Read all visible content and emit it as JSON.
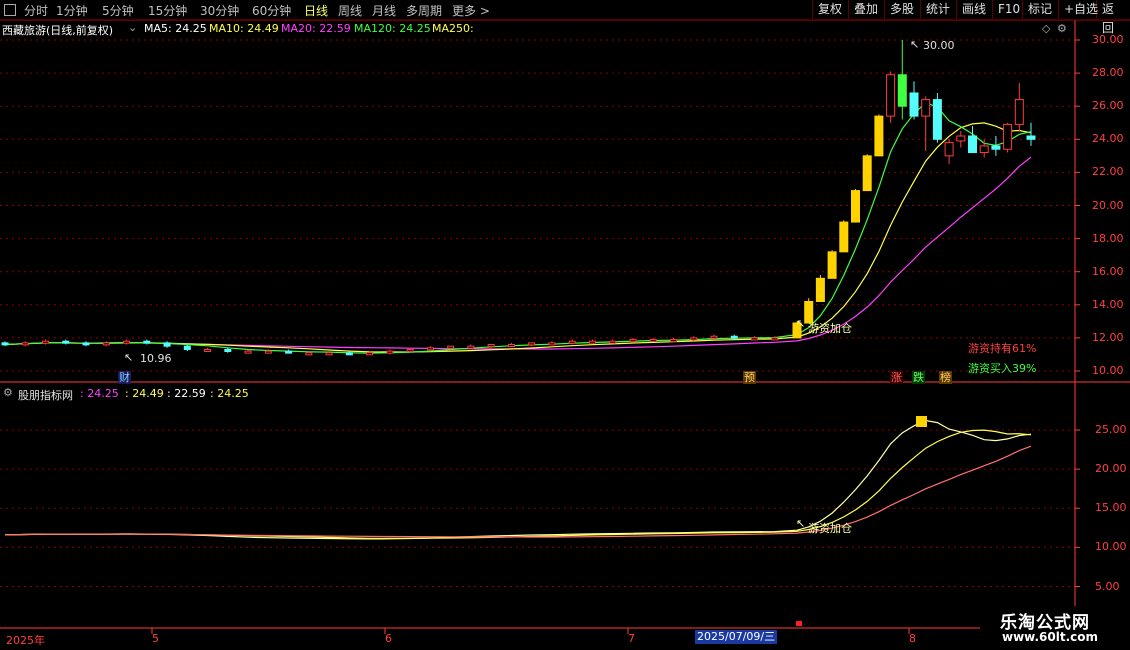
{
  "toolbar": {
    "periods": [
      "分时",
      "1分钟",
      "5分钟",
      "15分钟",
      "30分钟",
      "60分钟",
      "日线",
      "周线",
      "月线",
      "多周期",
      "更多"
    ],
    "active_period": "日线",
    "right_buttons": [
      "复权",
      "叠加",
      "多股",
      "统计",
      "画线",
      "F10",
      "标记",
      "+自选",
      "返回"
    ]
  },
  "header": {
    "stock_title": "西藏旅游(日线,前复权)",
    "ma5": "MA5: 24.25",
    "ma10": "MA10: 24.49",
    "ma20": "MA20: 22.59",
    "ma120": "MA120: 24.25",
    "ma250": "MA250:"
  },
  "main_chart": {
    "y_ticks": [
      "30.00",
      "28.00",
      "26.00",
      "24.00",
      "22.00",
      "20.00",
      "18.00",
      "16.00",
      "14.00",
      "12.00",
      "10.00"
    ],
    "high_label": "30.00",
    "low_label": "10.96",
    "annotation": "游资加仓",
    "hold_text": "游资持有61%",
    "buy_text": "游资买入39%",
    "markers": {
      "cai": "财",
      "yu": "预",
      "zhang": "涨",
      "die": "跌",
      "bang": "榜"
    }
  },
  "indicator": {
    "title": "股朋指标网",
    "values": [
      ": 24.25",
      ": 24.49",
      ": 22.59",
      ": 24.25"
    ],
    "y_ticks": [
      "25.00",
      "20.00",
      "15.00",
      "10.00",
      "5.00"
    ],
    "annotation": "游资加仓"
  },
  "x_axis": {
    "labels": [
      "2025年",
      "5",
      "6",
      "7",
      "8"
    ],
    "cursor_date": "2025/07/09/三"
  },
  "brand": {
    "title": "乐淘公式网",
    "url": "www.60lt.com"
  },
  "colors": {
    "up": "#ff3c3c",
    "down_cyan": "#54fcfc",
    "limit_up": "#ffd200",
    "ma5": "#ffffff",
    "ma10": "#ffff4d",
    "ma20": "#ff40ff",
    "ma120": "#40ff40",
    "grid": "#8b0000",
    "axis": "#ff3c3c"
  },
  "chart_data": {
    "type": "candlestick",
    "series": [
      {
        "name": "MA5",
        "values": [
          24.25
        ]
      },
      {
        "name": "MA10",
        "values": [
          24.49
        ]
      },
      {
        "name": "MA20",
        "values": [
          22.59
        ]
      },
      {
        "name": "MA120",
        "values": [
          24.25
        ]
      }
    ],
    "candles": [
      [
        11.7,
        11.8,
        11.5,
        11.6
      ],
      [
        11.6,
        11.8,
        11.5,
        11.7
      ],
      [
        11.7,
        11.9,
        11.6,
        11.8
      ],
      [
        11.8,
        11.9,
        11.6,
        11.7
      ],
      [
        11.7,
        11.8,
        11.5,
        11.6
      ],
      [
        11.6,
        11.8,
        11.5,
        11.7
      ],
      [
        11.7,
        11.9,
        11.6,
        11.8
      ],
      [
        11.8,
        11.9,
        11.6,
        11.7
      ],
      [
        11.7,
        11.8,
        11.4,
        11.5
      ],
      [
        11.5,
        11.6,
        11.2,
        11.3
      ],
      [
        11.3,
        11.4,
        11.2,
        11.3
      ],
      [
        11.3,
        11.4,
        11.1,
        11.2
      ],
      [
        11.2,
        11.3,
        11.1,
        11.2
      ],
      [
        11.2,
        11.3,
        11.1,
        11.2
      ],
      [
        11.2,
        11.3,
        11.1,
        11.1
      ],
      [
        11.1,
        11.2,
        11.0,
        11.1
      ],
      [
        11.1,
        11.2,
        11.0,
        11.1
      ],
      [
        11.1,
        11.2,
        10.96,
        11.0
      ],
      [
        11.0,
        11.2,
        11.0,
        11.1
      ],
      [
        11.1,
        11.3,
        11.0,
        11.2
      ],
      [
        11.2,
        11.4,
        11.1,
        11.3
      ],
      [
        11.3,
        11.5,
        11.2,
        11.4
      ],
      [
        11.4,
        11.5,
        11.3,
        11.5
      ],
      [
        11.5,
        11.6,
        11.4,
        11.5
      ],
      [
        11.5,
        11.6,
        11.4,
        11.6
      ],
      [
        11.6,
        11.7,
        11.5,
        11.6
      ],
      [
        11.6,
        11.7,
        11.5,
        11.7
      ],
      [
        11.7,
        11.8,
        11.6,
        11.7
      ],
      [
        11.7,
        11.9,
        11.6,
        11.8
      ],
      [
        11.8,
        11.9,
        11.7,
        11.8
      ],
      [
        11.8,
        11.9,
        11.7,
        11.8
      ],
      [
        11.8,
        12.0,
        11.7,
        11.9
      ],
      [
        11.9,
        12.0,
        11.8,
        11.9
      ],
      [
        11.9,
        12.0,
        11.8,
        11.9
      ],
      [
        11.9,
        12.1,
        11.8,
        12.0
      ],
      [
        12.0,
        12.2,
        11.9,
        12.1
      ],
      [
        12.1,
        12.2,
        11.9,
        12.0
      ],
      [
        12.0,
        12.1,
        11.9,
        12.0
      ],
      [
        12.0,
        12.1,
        11.9,
        12.0
      ],
      [
        12.0,
        13.0,
        12.0,
        12.9
      ],
      [
        12.9,
        14.4,
        12.9,
        14.2
      ],
      [
        14.2,
        15.8,
        14.2,
        15.6
      ],
      [
        15.6,
        17.3,
        15.6,
        17.2
      ],
      [
        17.2,
        19.1,
        17.2,
        19.0
      ],
      [
        19.0,
        21.0,
        19.0,
        20.9
      ],
      [
        20.9,
        23.1,
        20.9,
        23.0
      ],
      [
        23.0,
        25.5,
        23.0,
        25.4
      ],
      [
        25.4,
        28.1,
        25.0,
        27.9
      ],
      [
        27.9,
        30.0,
        25.2,
        26.0
      ],
      [
        26.8,
        27.5,
        25.2,
        25.4
      ],
      [
        25.4,
        26.6,
        23.3,
        26.4
      ],
      [
        26.4,
        26.8,
        23.8,
        24.0
      ],
      [
        23.0,
        24.0,
        22.5,
        23.8
      ],
      [
        23.9,
        24.5,
        23.5,
        24.2
      ],
      [
        24.2,
        24.8,
        23.2,
        23.2
      ],
      [
        23.2,
        24.0,
        22.9,
        23.6
      ],
      [
        23.6,
        24.2,
        23.0,
        23.4
      ],
      [
        23.4,
        25.0,
        23.2,
        24.9
      ],
      [
        24.9,
        27.4,
        24.5,
        26.4
      ],
      [
        24.2,
        25.0,
        23.6,
        24.0
      ]
    ]
  }
}
